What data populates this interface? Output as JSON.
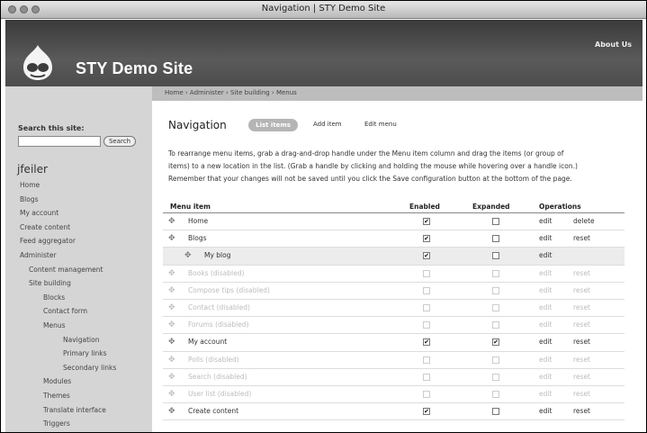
{
  "window": {
    "title": "Navigation | STY Demo Site"
  },
  "header": {
    "site_name": "STY Demo Site",
    "about_link": "About Us"
  },
  "breadcrumb": "Home › Administer › Site building › Menus",
  "sidebar": {
    "search_label": "Search this site:",
    "search_button": "Search",
    "username": "jfeiler",
    "items": [
      {
        "label": "Home",
        "indent": 0
      },
      {
        "label": "Blogs",
        "indent": 0
      },
      {
        "label": "My account",
        "indent": 0
      },
      {
        "label": "Create content",
        "indent": 0
      },
      {
        "label": "Feed aggregator",
        "indent": 0
      },
      {
        "label": "Administer",
        "indent": 0
      },
      {
        "label": "Content management",
        "indent": 1
      },
      {
        "label": "Site building",
        "indent": 1
      },
      {
        "label": "Blocks",
        "indent": 2
      },
      {
        "label": "Contact form",
        "indent": 2
      },
      {
        "label": "Menus",
        "indent": 2
      },
      {
        "label": "Navigation",
        "indent": 3
      },
      {
        "label": "Primary links",
        "indent": 3
      },
      {
        "label": "Secondary links",
        "indent": 3
      },
      {
        "label": "Modules",
        "indent": 2
      },
      {
        "label": "Themes",
        "indent": 2
      },
      {
        "label": "Translate interface",
        "indent": 2
      },
      {
        "label": "Triggers",
        "indent": 2
      }
    ]
  },
  "main": {
    "title": "Navigation",
    "tabs": {
      "list": "List items",
      "add": "Add item",
      "edit": "Edit menu"
    },
    "intro_1": "To rearrange menu items, grab a drag-and-drop handle under the Menu item column and drag the items (or group of",
    "intro_2": "items) to a new location in the list. (Grab a handle by clicking and holding the mouse while hovering over a handle icon.)",
    "intro_3": "Remember that your changes will not be saved until you click the Save configuration button at the bottom of the page.",
    "headers": {
      "menu_item": "Menu item",
      "enabled": "Enabled",
      "expanded": "Expanded",
      "operations": "Operations"
    },
    "rows": [
      {
        "name": "Home",
        "enabled": true,
        "expanded": false,
        "op1": "edit",
        "op2": "delete",
        "disabled": false,
        "indent": 0,
        "highlight": false
      },
      {
        "name": "Blogs",
        "enabled": true,
        "expanded": false,
        "op1": "edit",
        "op2": "reset",
        "disabled": false,
        "indent": 0,
        "highlight": false
      },
      {
        "name": "My blog",
        "enabled": true,
        "expanded": false,
        "op1": "edit",
        "op2": "",
        "disabled": false,
        "indent": 1,
        "highlight": true
      },
      {
        "name": "Books (disabled)",
        "enabled": false,
        "expanded": false,
        "op1": "edit",
        "op2": "reset",
        "disabled": true,
        "indent": 0,
        "highlight": false
      },
      {
        "name": "Compose tips (disabled)",
        "enabled": false,
        "expanded": false,
        "op1": "edit",
        "op2": "reset",
        "disabled": true,
        "indent": 0,
        "highlight": false
      },
      {
        "name": "Contact (disabled)",
        "enabled": false,
        "expanded": false,
        "op1": "edit",
        "op2": "reset",
        "disabled": true,
        "indent": 0,
        "highlight": false
      },
      {
        "name": "Forums (disabled)",
        "enabled": false,
        "expanded": false,
        "op1": "edit",
        "op2": "reset",
        "disabled": true,
        "indent": 0,
        "highlight": false
      },
      {
        "name": "My account",
        "enabled": true,
        "expanded": true,
        "op1": "edit",
        "op2": "reset",
        "disabled": false,
        "indent": 0,
        "highlight": false
      },
      {
        "name": "Polls (disabled)",
        "enabled": false,
        "expanded": false,
        "op1": "edit",
        "op2": "reset",
        "disabled": true,
        "indent": 0,
        "highlight": false
      },
      {
        "name": "Search (disabled)",
        "enabled": false,
        "expanded": false,
        "op1": "edit",
        "op2": "reset",
        "disabled": true,
        "indent": 0,
        "highlight": false
      },
      {
        "name": "User list (disabled)",
        "enabled": false,
        "expanded": false,
        "op1": "edit",
        "op2": "reset",
        "disabled": true,
        "indent": 0,
        "highlight": false
      },
      {
        "name": "Create content",
        "enabled": true,
        "expanded": false,
        "op1": "edit",
        "op2": "reset",
        "disabled": false,
        "indent": 0,
        "highlight": false
      }
    ]
  }
}
